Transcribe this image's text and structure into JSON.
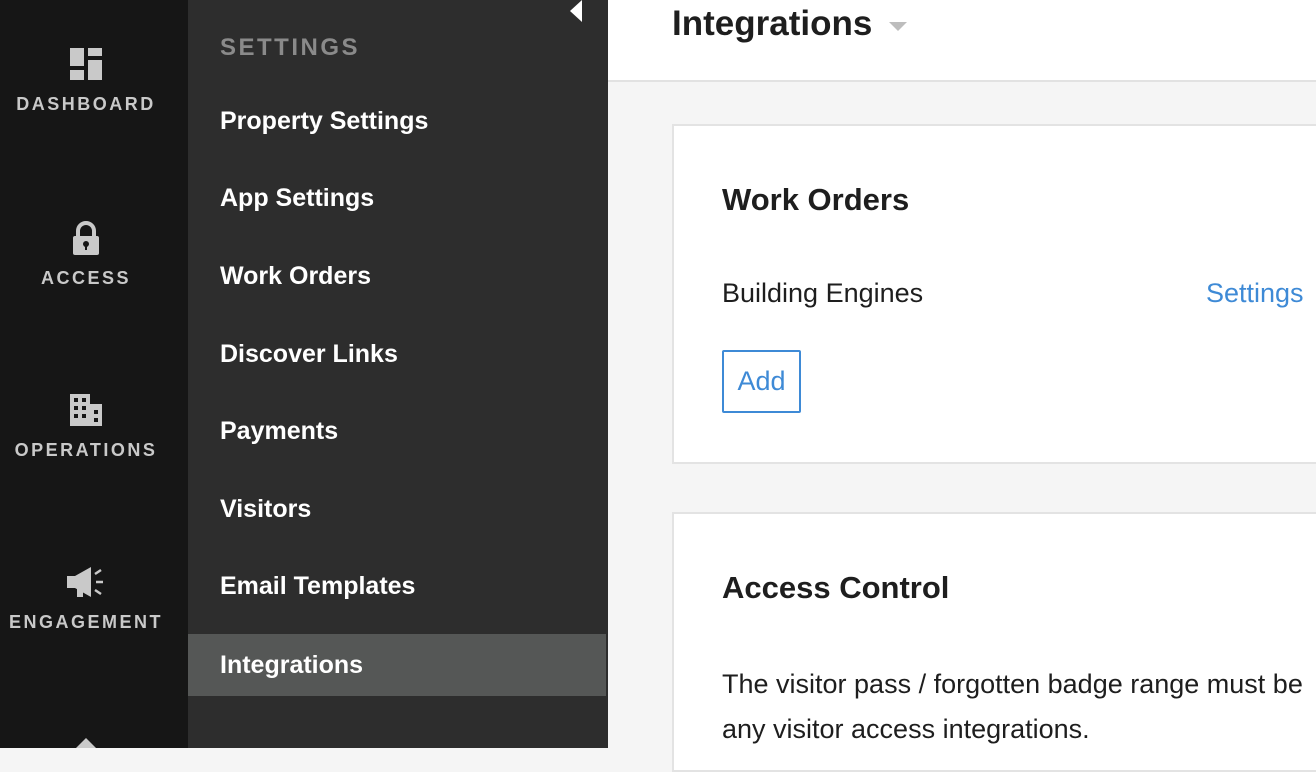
{
  "rail": {
    "items": [
      {
        "label": "DASHBOARD",
        "icon": "dashboard-icon"
      },
      {
        "label": "ACCESS",
        "icon": "lock-icon"
      },
      {
        "label": "OPERATIONS",
        "icon": "building-icon"
      },
      {
        "label": "ENGAGEMENT",
        "icon": "megaphone-icon"
      }
    ]
  },
  "submenu": {
    "heading": "SETTINGS",
    "items": [
      {
        "label": "Property Settings"
      },
      {
        "label": "App Settings"
      },
      {
        "label": "Work Orders"
      },
      {
        "label": "Discover Links"
      },
      {
        "label": "Payments"
      },
      {
        "label": "Visitors"
      },
      {
        "label": "Email Templates"
      },
      {
        "label": "Integrations",
        "active": true
      }
    ]
  },
  "header": {
    "title": "Integrations"
  },
  "work_orders": {
    "title": "Work Orders",
    "integration": "Building Engines",
    "settings_link": "Settings",
    "add_button": "Add"
  },
  "access_control": {
    "title": "Access Control",
    "body_line1": "The visitor pass / forgotten badge range must be",
    "body_line2": "any visitor access integrations."
  },
  "colors": {
    "accent": "#3e8ad6",
    "rail_bg": "#161616",
    "submenu_bg": "#2d2d2d",
    "active_item": "#555756"
  }
}
